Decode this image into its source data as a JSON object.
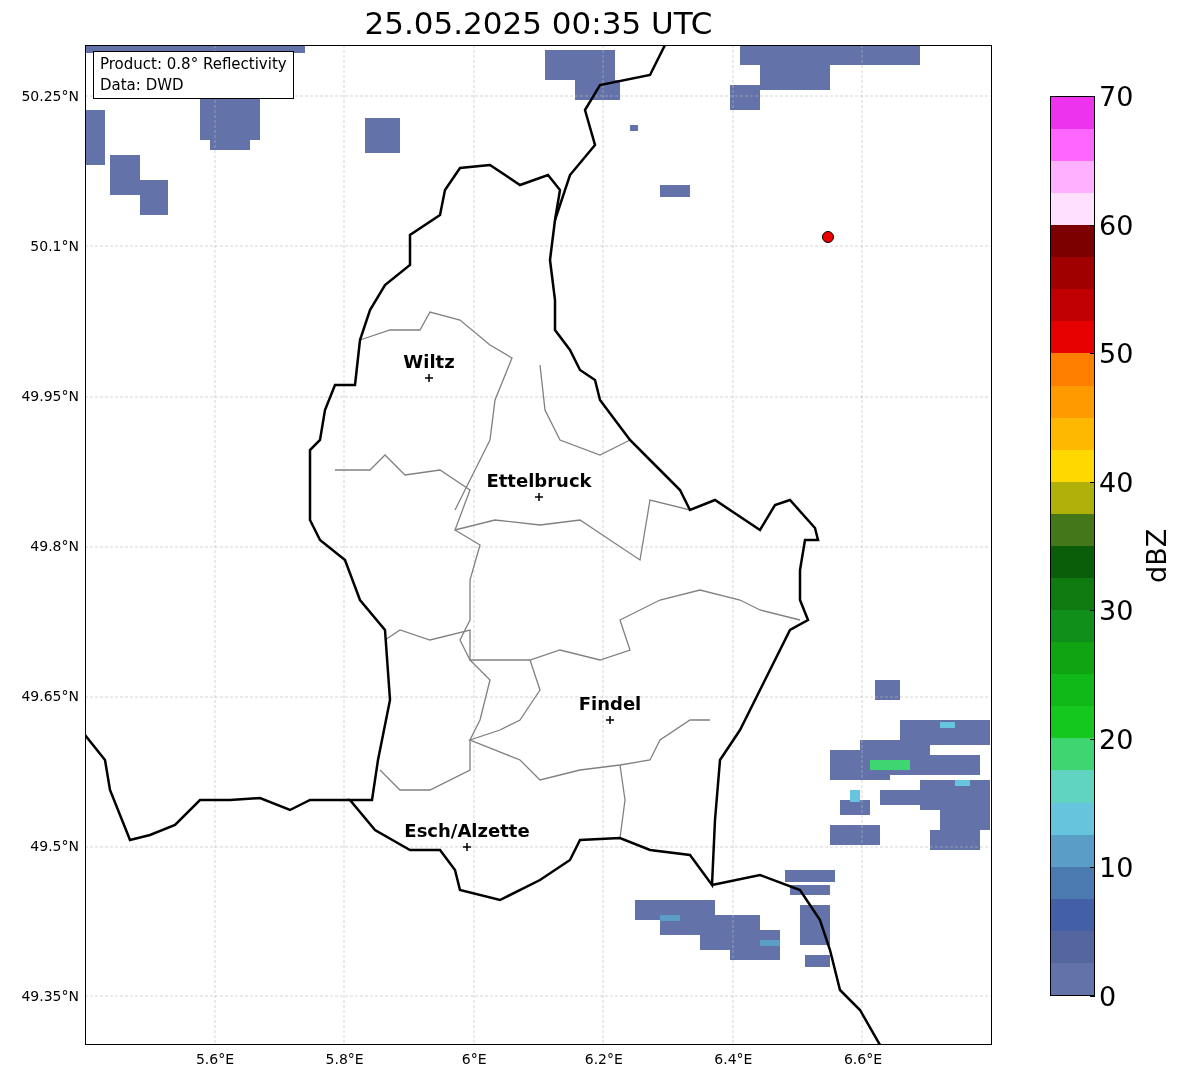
{
  "title": "25.05.2025 00:35 UTC",
  "map": {
    "info": [
      "Product: 0.8° Reflectivity",
      "Data: DWD"
    ],
    "lat_ticks": [
      "50.25°N",
      "50.1°N",
      "49.95°N",
      "49.8°N",
      "49.65°N",
      "49.5°N",
      "49.35°N"
    ],
    "lon_ticks": [
      "5.6°E",
      "5.8°E",
      "6°E",
      "6.2°E",
      "6.4°E",
      "6.6°E"
    ],
    "places": [
      {
        "name": "Wiltz"
      },
      {
        "name": "Ettelbruck"
      },
      {
        "name": "Findel"
      },
      {
        "name": "Esch/Alzette"
      }
    ]
  },
  "colorbar": {
    "label": "dBZ",
    "ticks": [
      "70",
      "60",
      "50",
      "40",
      "30",
      "20",
      "10",
      "0"
    ],
    "bins": [
      {
        "color": "#6373a9"
      },
      {
        "color": "#53679e"
      },
      {
        "color": "#4360a6"
      },
      {
        "color": "#4a7ab0"
      },
      {
        "color": "#5a9ec8"
      },
      {
        "color": "#66c4dc"
      },
      {
        "color": "#60d4c0"
      },
      {
        "color": "#3dd670"
      },
      {
        "color": "#14c81e"
      },
      {
        "color": "#10b818"
      },
      {
        "color": "#10a412"
      },
      {
        "color": "#10901a"
      },
      {
        "color": "#0e7a10"
      },
      {
        "color": "#0a5e0a"
      },
      {
        "color": "#44761a"
      },
      {
        "color": "#b0b00a"
      },
      {
        "color": "#ffd800"
      },
      {
        "color": "#ffb800"
      },
      {
        "color": "#ff9a00"
      },
      {
        "color": "#ff7e00"
      },
      {
        "color": "#e60000"
      },
      {
        "color": "#c00000"
      },
      {
        "color": "#a00000"
      },
      {
        "color": "#7c0000"
      },
      {
        "color": "#ffe0ff"
      },
      {
        "color": "#ffb0ff"
      },
      {
        "color": "#ff66ff"
      },
      {
        "color": "#ee33ee"
      }
    ]
  }
}
